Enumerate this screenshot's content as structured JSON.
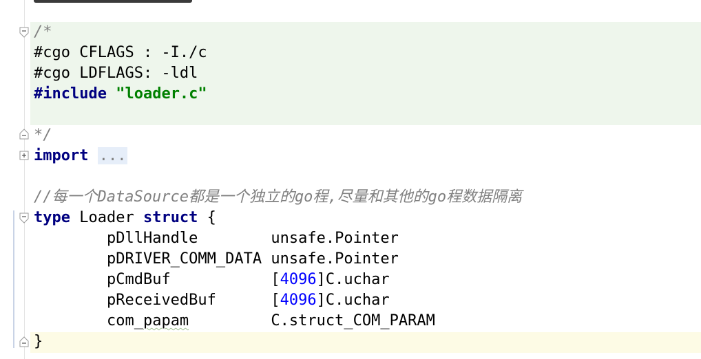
{
  "editor": {
    "language": "go",
    "colors": {
      "keyword": "#000080",
      "comment": "#808080",
      "string": "#008000",
      "number": "#0000ff",
      "injected_bg": "#eef6ec",
      "caret_line_bg": "#fdfbe5"
    },
    "lines": [
      {
        "text": "/*"
      },
      {
        "text": "#cgo CFLAGS : -I./c"
      },
      {
        "text": "#cgo LDFLAGS: -ldl"
      },
      {
        "directive": "#include",
        "space": " ",
        "string": "\"loader.c\""
      },
      {
        "text": ""
      },
      {
        "text": "*/"
      },
      {
        "keyword": "import",
        "space": " ",
        "folded": "..."
      },
      {
        "text": ""
      },
      {
        "comment": "//每一个DataSource都是一个独立的go程,尽量和其他的go程数据隔离"
      },
      {
        "kw1": "type",
        "ident": " Loader ",
        "kw2": "struct",
        "rest": " {"
      },
      {
        "indent": "        ",
        "field": "pDllHandle",
        "pad": "        ",
        "type": "unsafe.Pointer"
      },
      {
        "indent": "        ",
        "field": "pDRIVER_COMM_DATA",
        "pad": " ",
        "type": "unsafe.Pointer"
      },
      {
        "indent": "        ",
        "field": "pCmdBuf",
        "pad": "           ",
        "open": "[",
        "num": "4096",
        "close": "]",
        "type": "C.uchar"
      },
      {
        "indent": "        ",
        "field": "pReceivedBuf",
        "pad": "      ",
        "open": "[",
        "num": "4096",
        "close": "]",
        "type": "C.uchar"
      },
      {
        "indent": "        ",
        "field_a": "com_",
        "field_b": "papam",
        "pad": "         ",
        "type": "C.struct_COM_PARAM"
      },
      {
        "text": "}"
      }
    ]
  }
}
